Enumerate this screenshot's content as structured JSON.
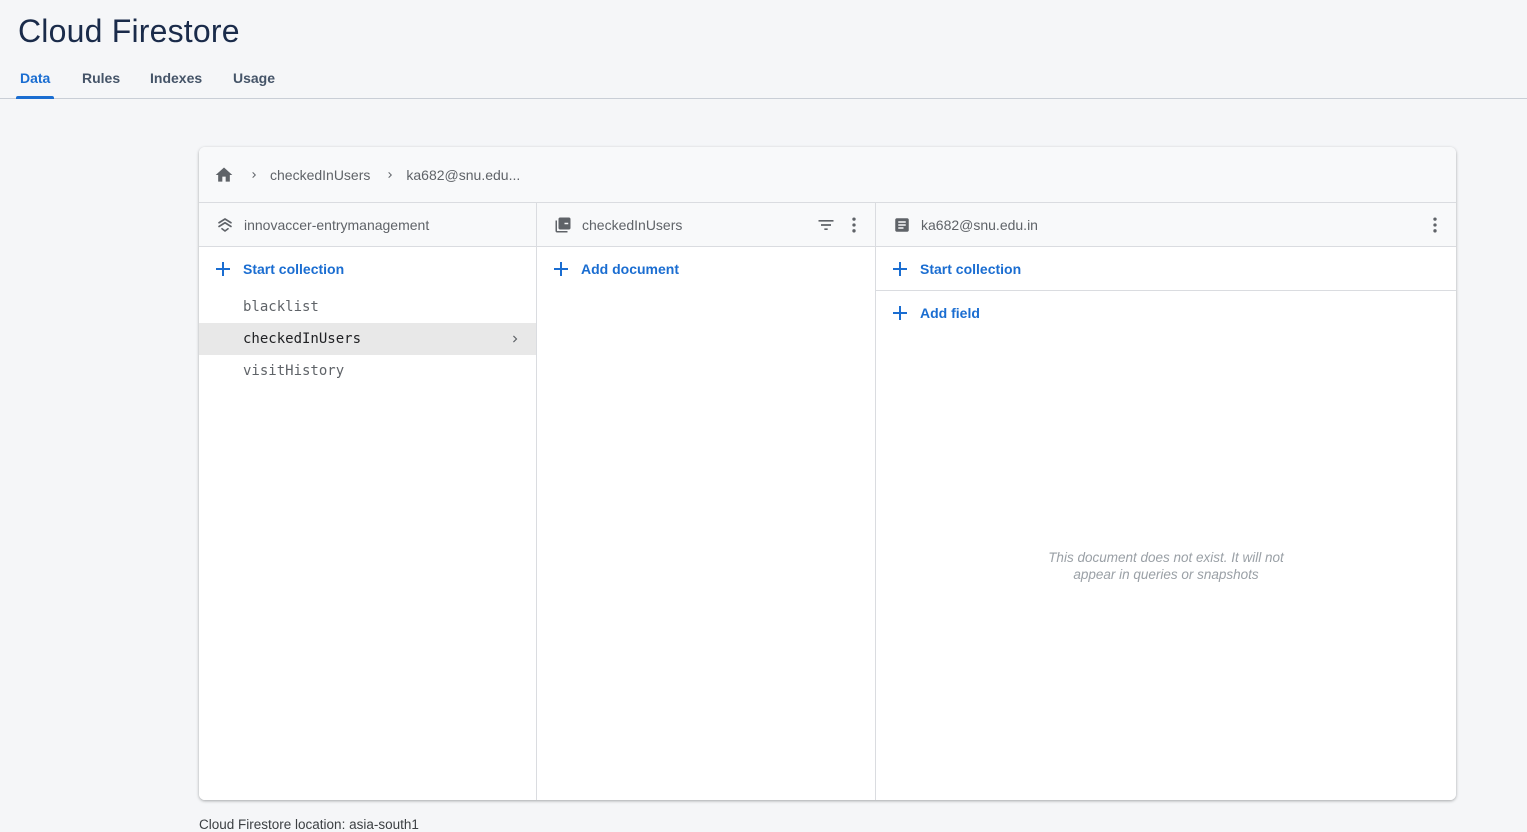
{
  "page": {
    "title": "Cloud Firestore"
  },
  "tabs": [
    {
      "label": "Data",
      "active": true
    },
    {
      "label": "Rules",
      "active": false
    },
    {
      "label": "Indexes",
      "active": false
    },
    {
      "label": "Usage",
      "active": false
    }
  ],
  "breadcrumb": {
    "home_icon": "home-icon",
    "items": [
      "checkedInUsers",
      "ka682@snu.edu..."
    ]
  },
  "columns": {
    "root": {
      "header": "innovaccer-entrymanagement",
      "icon": "database-stack-icon",
      "action": "Start collection",
      "collections": [
        {
          "name": "blacklist",
          "selected": false
        },
        {
          "name": "checkedInUsers",
          "selected": true
        },
        {
          "name": "visitHistory",
          "selected": false
        }
      ]
    },
    "collection": {
      "header": "checkedInUsers",
      "icon": "collection-icon",
      "action": "Add document"
    },
    "document": {
      "header": "ka682@snu.edu.in",
      "icon": "document-icon",
      "action_collection": "Start collection",
      "action_field": "Add field",
      "empty_line1": "This document does not exist. It will not",
      "empty_line2": "appear in queries or snapshots"
    }
  },
  "footer": {
    "location": "Cloud Firestore location: asia-south1"
  },
  "colors": {
    "accent": "#1a6dd1",
    "muted": "#5f6368"
  }
}
